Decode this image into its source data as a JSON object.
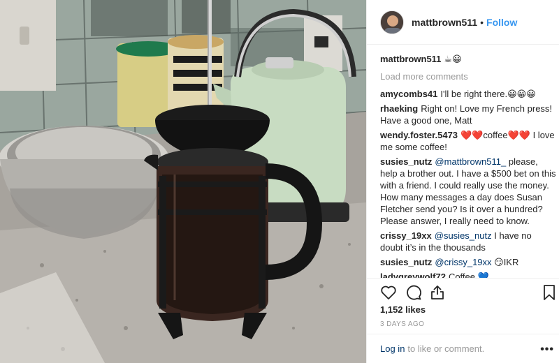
{
  "post": {
    "author": "mattbrown511",
    "follow_label": "Follow",
    "caption_user": "mattbrown511",
    "caption_text": "☕😀",
    "load_more": "Load more comments",
    "comments": [
      {
        "user": "amycombs41",
        "parts": [
          {
            "t": "I'll be right there.😀😀😀"
          }
        ]
      },
      {
        "user": "rhaeking",
        "parts": [
          {
            "t": "Right on! Love my French press! Have a good one, Matt"
          }
        ]
      },
      {
        "user": "wendy.foster.5473",
        "parts": [
          {
            "t": "❤️❤️coffee❤️❤️ I love me some coffee!"
          }
        ]
      },
      {
        "user": "susies_nutz",
        "parts": [
          {
            "t": "@mattbrown511_",
            "m": true
          },
          {
            "t": " please, help a brother out. I have a $500 bet on this with a friend. I could really use the money. How many messages a day does Susan Fletcher send you? Is it over a hundred? Please answer, I really need to know."
          }
        ]
      },
      {
        "user": "crissy_19xx",
        "parts": [
          {
            "t": "@susies_nutz",
            "m": true
          },
          {
            "t": " I have no doubt it’s in the thousands"
          }
        ]
      },
      {
        "user": "susies_nutz",
        "parts": [
          {
            "t": "@crissy_19xx",
            "m": true
          },
          {
            "t": " 😏IKR"
          }
        ]
      },
      {
        "user": "ladygreywolf72",
        "parts": [
          {
            "t": "Coffee 💙"
          }
        ]
      }
    ],
    "likes": "1,152 likes",
    "timestamp": "3 DAYS AGO",
    "login_link": "Log in",
    "login_rest": "to like or comment.",
    "more_label": "•••"
  },
  "icons": {
    "like": "heart-icon",
    "comment": "comment-bubble-icon",
    "share": "share-icon",
    "save": "bookmark-icon"
  }
}
